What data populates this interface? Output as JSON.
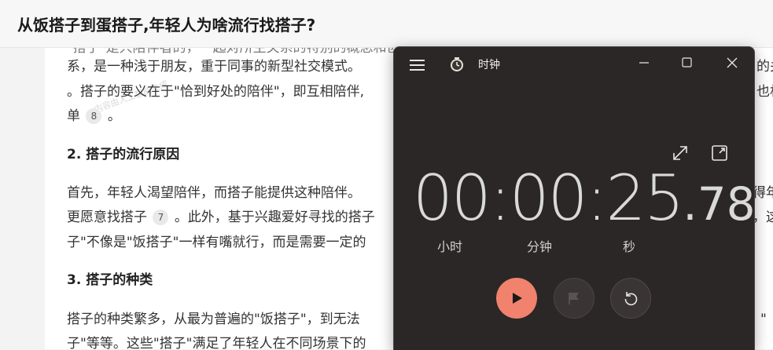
{
  "article": {
    "title": "从饭搭子到蛋搭子,年轻人为啥流行找搭子?",
    "watermark": "内容由人工智能生成",
    "lines": [
      "\"搭子\"是只陪伴者的，一起对所生关系的特别的概念和创造性生活的活动",
      "系，是一种浅于朋友，重于同事的新型社交模式。",
      "。搭子的要义在于\"恰到好处的陪伴\"，即互相陪伴,",
      "单"
    ],
    "line4_tail": "。",
    "right_fragments": [
      "的关",
      "也相"
    ],
    "cite_8": "8",
    "section2_heading": "2. 搭子的流行原因",
    "section2_lines": [
      "首先，年轻人渴望陪伴，而搭子能提供这种陪伴。",
      "更愿意找搭子",
      "子\"不像是\"饭搭子\"一样有嘴就行，而是需要一定的"
    ],
    "section2_line2_tail": "。此外，基于兴趣爱好寻找的搭子",
    "section2_right": [
      "得年",
      "，这"
    ],
    "cite_7": "7",
    "section3_heading": "3. 搭子的种类",
    "section3_lines": [
      "搭子的种类繁多，从最为普遍的\"饭搭子\"，到无法",
      "子\"等等。这些\"搭子\"满足了年轻人在不同场景下的"
    ],
    "section3_right": "\""
  },
  "clock": {
    "app_title": "时钟",
    "time_main": "00:00:25",
    "time_fraction": ".78",
    "label_hours": "小时",
    "label_minutes": "分钟",
    "label_seconds": "秒",
    "colors": {
      "play_accent": "#f0826e",
      "window_bg": "#2b2726"
    }
  }
}
